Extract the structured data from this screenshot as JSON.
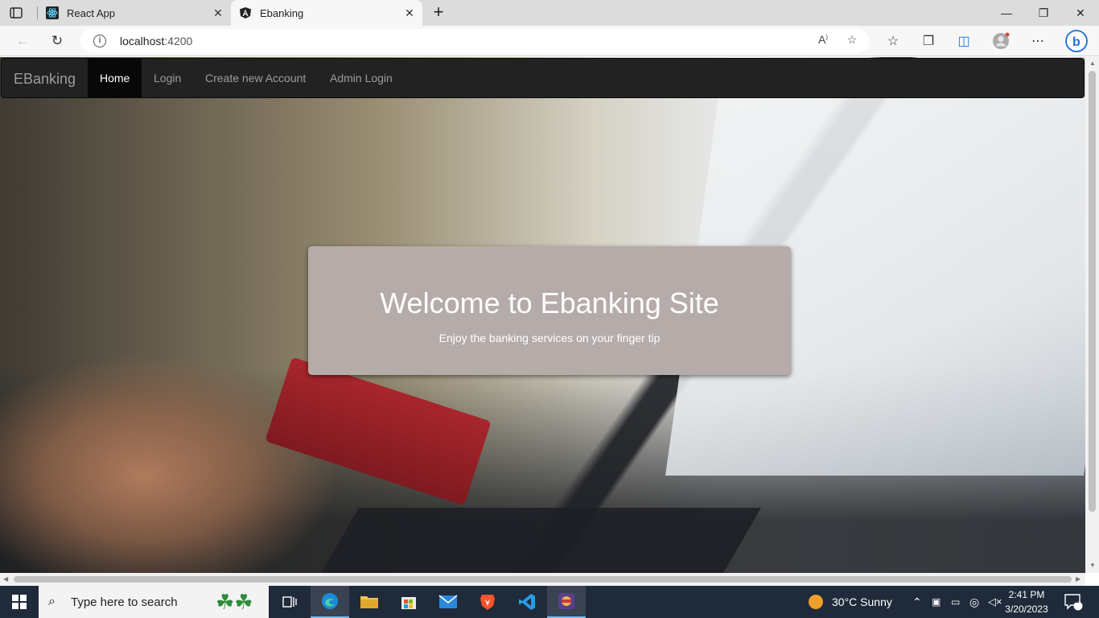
{
  "browser": {
    "tabs": [
      {
        "title": "React App",
        "icon": "react-icon"
      },
      {
        "title": "Ebanking",
        "icon": "angular-icon"
      }
    ],
    "url_host": "localhost",
    "url_port": ":4200"
  },
  "navbar": {
    "brand": "EBanking",
    "links": [
      "Home",
      "Login",
      "Create new Account",
      "Admin Login"
    ],
    "active": "Home"
  },
  "hero": {
    "title": "Welcome to Ebanking Site",
    "subtitle": "Enjoy the banking services on your finger tip"
  },
  "taskbar": {
    "search_placeholder": "Type here to search",
    "weather": "30°C  Sunny",
    "time": "2:41 PM",
    "date": "3/20/2023",
    "notifications": "2"
  }
}
